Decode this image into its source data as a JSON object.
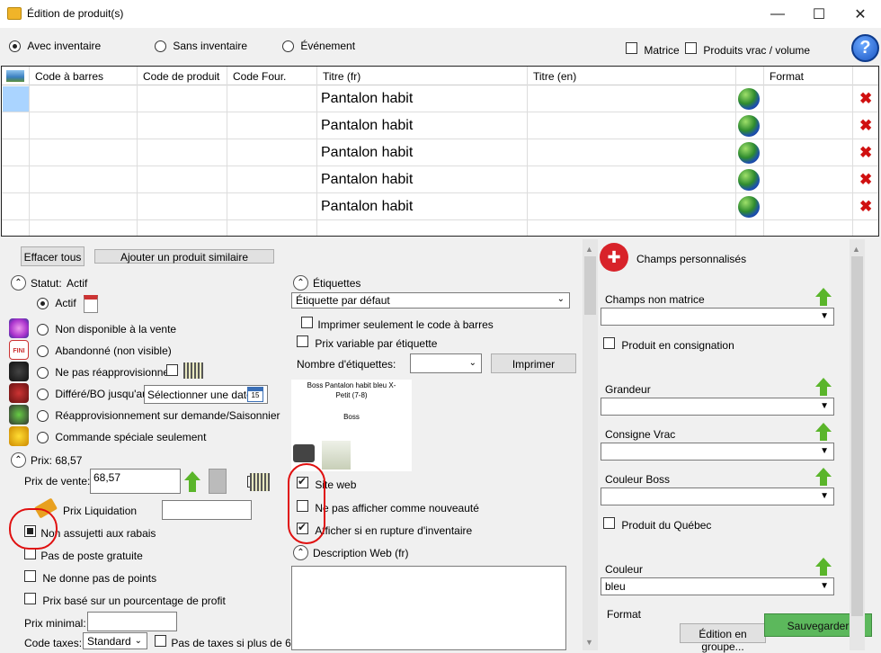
{
  "window": {
    "title": "Édition de produit(s)"
  },
  "modes": [
    {
      "label": "Avec inventaire",
      "selected": true
    },
    {
      "label": "Sans inventaire",
      "selected": false
    },
    {
      "label": "Événement",
      "selected": false
    }
  ],
  "top_checks": {
    "matrice": "Matrice",
    "vrac": "Produits vrac / volume"
  },
  "grid": {
    "headers": [
      "Code à barres",
      "Code de produit",
      "Code Four.",
      "Titre (fr)",
      "Titre (en)",
      "Format"
    ],
    "rows": [
      "Pantalon habit",
      "Pantalon habit",
      "Pantalon habit",
      "Pantalon habit",
      "Pantalon habit"
    ]
  },
  "buttons": {
    "clear_all": "Effacer tous",
    "add_similar": "Ajouter un produit similaire",
    "print": "Imprimer",
    "save": "Sauvegarder",
    "group_edit": "Édition en groupe..."
  },
  "status": {
    "header": "Statut:",
    "value": "Actif",
    "options": [
      "Actif",
      "Non disponible à la vente",
      "Abandonné (non visible)",
      "Ne pas réapprovisionner",
      "Différé/BO jusqu'au",
      "Réapprovisionnement sur demande/Saisonnier",
      "Commande spéciale seulement"
    ],
    "date_placeholder": "Sélectionner une date"
  },
  "price": {
    "header": "Prix: 68,57",
    "sale_label": "Prix de vente:",
    "sale_value": "68,57",
    "liquidation_label": "Prix Liquidation",
    "checks": [
      "Non assujetti aux rabais",
      "Pas de poste gratuite",
      "Ne donne pas de points",
      "Prix basé sur un pourcentage de profit"
    ],
    "min_label": "Prix minimal:",
    "tax_label": "Code taxes:",
    "tax_value": "Standard",
    "tax_check": "Pas de taxes si plus de 6"
  },
  "labels": {
    "header": "Étiquettes",
    "default": "Étiquette par défaut",
    "print_barcode": "Imprimer seulement le code à barres",
    "variable_price": "Prix variable par étiquette",
    "count_label": "Nombre d'étiquettes:",
    "preview_line1": "Boss Pantalon habit  bleu X-",
    "preview_line2": "Petit (7-8)",
    "preview_brand": "Boss"
  },
  "web": {
    "site_web": "Site web",
    "not_new": "Ne pas afficher comme nouveauté",
    "show_out": "Afficher si en rupture d'inventaire",
    "desc_header": "Description Web (fr)"
  },
  "custom": {
    "header": "Champs personnalisés",
    "non_matrix": "Champs non matrice",
    "consignment": "Produit en consignation",
    "size": "Grandeur",
    "bulk": "Consigne Vrac",
    "boss_color": "Couleur Boss",
    "quebec": "Produit du Québec",
    "color": "Couleur",
    "color_value": "bleu",
    "format": "Format"
  },
  "colors": {
    "delete": "#d01010",
    "save_bg": "#5cb85c",
    "highlight": "#e01010"
  }
}
